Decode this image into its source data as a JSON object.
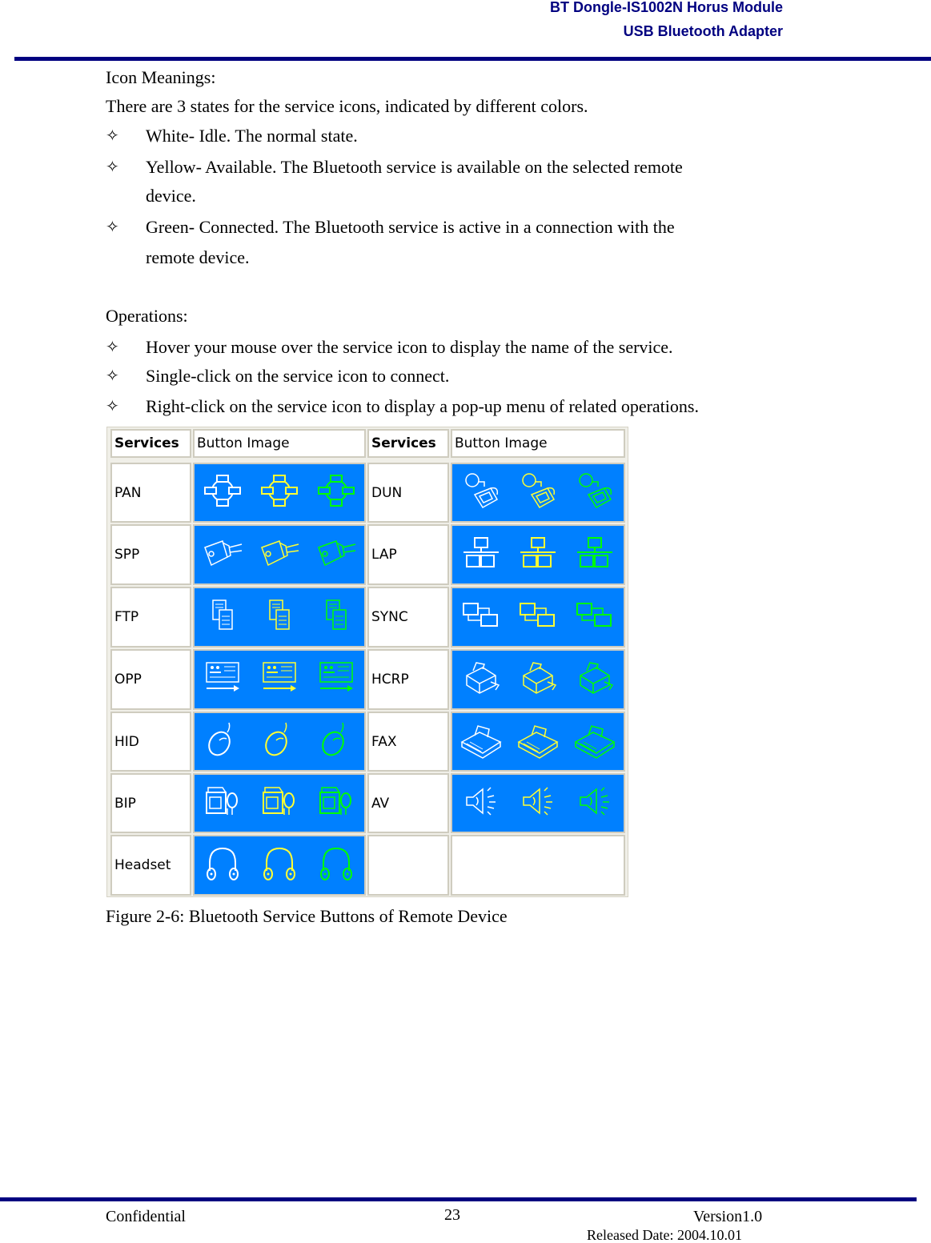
{
  "header": {
    "line1": "BT Dongle-IS1002N Horus Module",
    "line2": "USB Bluetooth Adapter"
  },
  "body": {
    "icon_meanings_title": "Icon Meanings:",
    "icon_meanings_intro": "There are 3 states for the service icons, indicated by different colors.",
    "bullet_glyph": "✧",
    "states": [
      {
        "line1": "White- Idle. The normal state.",
        "line2": ""
      },
      {
        "line1": "Yellow- Available. The Bluetooth service is available on the selected remote",
        "line2": "device."
      },
      {
        "line1": "Green- Connected. The Bluetooth service is active in a connection with the",
        "line2": "remote device."
      }
    ],
    "operations_title": "Operations:",
    "operations": [
      "Hover your mouse over the service icon to display the name of the service.",
      "Single-click on the service icon to connect.",
      "Right-click on the service icon to display a pop-up menu of related operations."
    ]
  },
  "figure": {
    "headers": [
      "Services",
      "Button Image",
      "Services",
      "Button Image"
    ],
    "state_colors": {
      "idle": "#ffffff",
      "available": "#ffff33",
      "connected": "#00ff00"
    },
    "button_bg": "#0080ff",
    "rows": [
      {
        "left": {
          "service": "PAN",
          "icon": "network-ring-icon"
        },
        "right": {
          "service": "DUN",
          "icon": "dialup-phone-icon"
        }
      },
      {
        "left": {
          "service": "SPP",
          "icon": "serial-plug-icon"
        },
        "right": {
          "service": "LAP",
          "icon": "lan-access-icon"
        }
      },
      {
        "left": {
          "service": "FTP",
          "icon": "file-transfer-icon"
        },
        "right": {
          "service": "SYNC",
          "icon": "sync-icon"
        }
      },
      {
        "left": {
          "service": "OPP",
          "icon": "object-push-icon"
        },
        "right": {
          "service": "HCRP",
          "icon": "printer-icon"
        }
      },
      {
        "left": {
          "service": "HID",
          "icon": "mouse-icon"
        },
        "right": {
          "service": "FAX",
          "icon": "fax-icon"
        }
      },
      {
        "left": {
          "service": "BIP",
          "icon": "camera-icon"
        },
        "right": {
          "service": "AV",
          "icon": "speaker-icon"
        }
      },
      {
        "left": {
          "service": "Headset",
          "icon": "headset-icon"
        },
        "right": {
          "service": "",
          "icon": ""
        }
      }
    ],
    "caption": "Figure 2-6: Bluetooth Service Buttons of Remote Device"
  },
  "footer": {
    "left": "Confidential",
    "page": "23",
    "version": "Version1.0",
    "released": "Released Date: 2004.10.01"
  }
}
